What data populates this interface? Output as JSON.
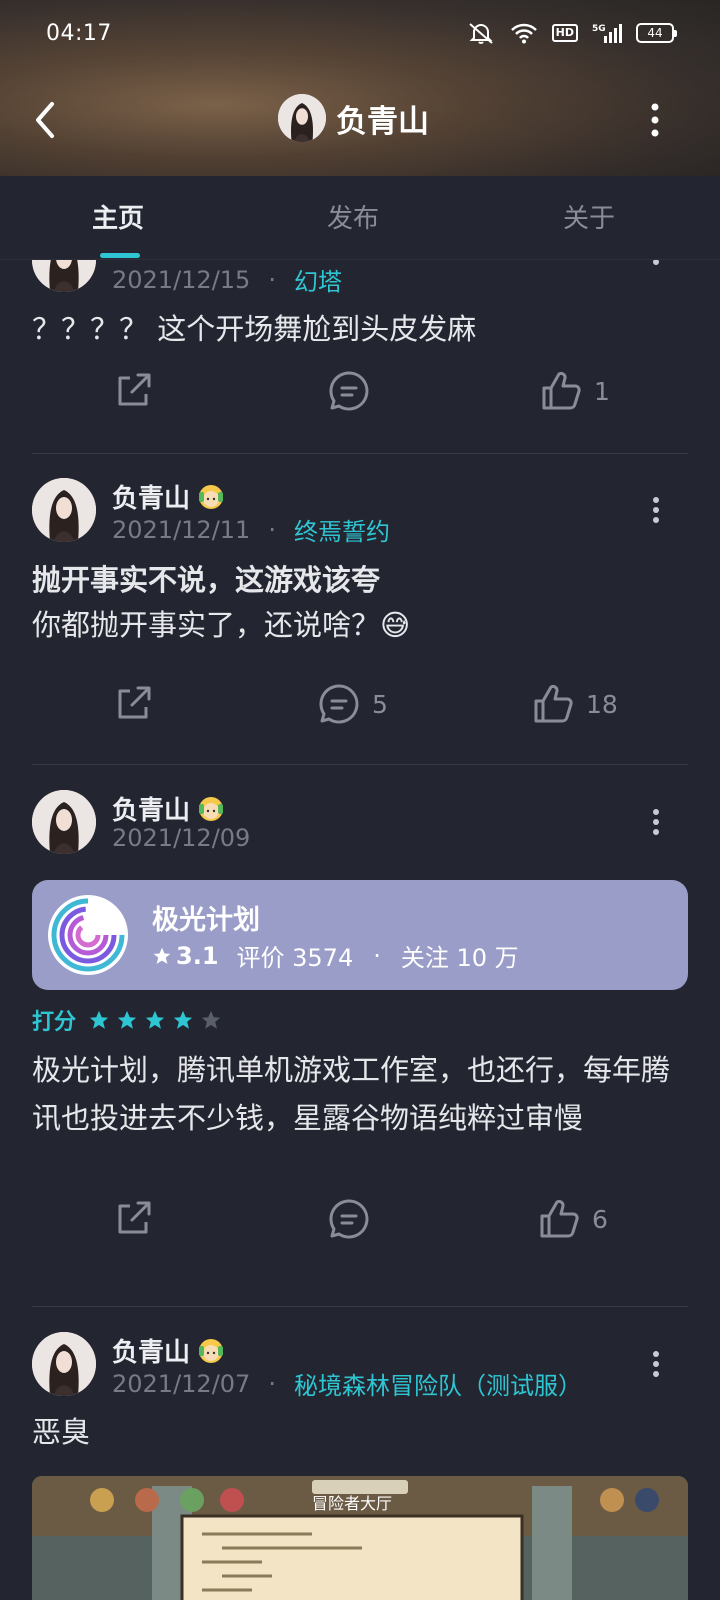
{
  "status_bar": {
    "time": "04:17",
    "battery": "44",
    "network": "5G",
    "hd": "HD"
  },
  "profile": {
    "name": "负青山"
  },
  "tabs": [
    "主页",
    "发布",
    "关于"
  ],
  "posts": [
    {
      "date": "2021/12/15",
      "game": "幻塔",
      "text": "？？？？ 这个开场舞尬到头皮发麻",
      "comments": "",
      "likes": "1"
    },
    {
      "author": "负青山",
      "date": "2021/12/11",
      "game": "终焉誓约",
      "title": "抛开事实不说，这游戏该夸",
      "text": "你都抛开事实了，还说啥？😅",
      "comments": "5",
      "likes": "18"
    },
    {
      "author": "负青山",
      "date": "2021/12/09",
      "app": {
        "name": "极光计划",
        "score": "3.1",
        "reviews": "评价 3574",
        "follows": "关注 10 万"
      },
      "rating_label": "打分",
      "rating_value": 4,
      "rating_max": 5,
      "text": "极光计划，腾讯单机游戏工作室，也还行，每年腾讯也投进去不少钱，星露谷物语纯粹过审慢",
      "comments": "",
      "likes": "6"
    },
    {
      "author": "负青山",
      "date": "2021/12/07",
      "game": "秘境森林冒险队（测试服）",
      "text": "恶臭",
      "image_caption": "冒险者大厅"
    }
  ],
  "colors": {
    "accent": "#2fc6d3",
    "background": "#232631",
    "card": "#9b9dc9"
  }
}
